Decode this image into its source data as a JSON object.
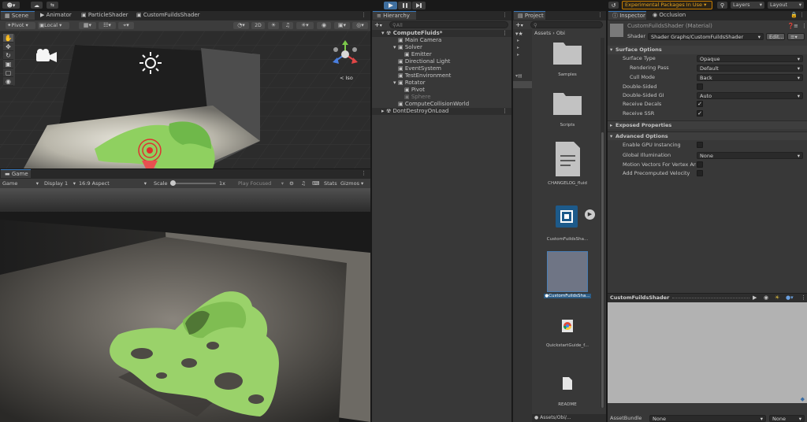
{
  "app": {
    "account_label": "▾",
    "cloud_icon": "cloud-icon",
    "collab_icon": "collab-icon"
  },
  "toolbar": {
    "play_icon": "play-icon",
    "pause_icon": "pause-icon",
    "step_icon": "step-icon",
    "experimental_label": "Experimental Packages In Use",
    "layers_label": "Layers",
    "layout_label": "Layout"
  },
  "scene": {
    "tabs": [
      "Scene",
      "Animator",
      "ParticleShader",
      "CustomFuildsShader"
    ],
    "pivot_label": "Pivot",
    "local_label": "Local",
    "mode_2d": "2D",
    "iso_label": "Iso",
    "light_color": "#f5f5f5"
  },
  "game": {
    "tab_label": "Game",
    "display_mode": "Game",
    "display": "Display 1",
    "aspect": "16:9 Aspect",
    "scale_label": "Scale",
    "scale_value": "1x",
    "play_focused": "Play Focused",
    "stats": "Stats",
    "gizmos": "Gizmos",
    "fluid_color": "#9ad26a"
  },
  "hierarchy": {
    "tab_label": "Hierarchy",
    "search_placeholder": "All",
    "items": [
      {
        "label": "ComputeFluids*",
        "depth": 0,
        "bold": true,
        "icon": "unity-scene-icon"
      },
      {
        "label": "Main Camera",
        "depth": 1,
        "icon": "gameobject-icon"
      },
      {
        "label": "Solver",
        "depth": 1,
        "icon": "gameobject-icon"
      },
      {
        "label": "Emitter",
        "depth": 2,
        "icon": "gameobject-icon"
      },
      {
        "label": "Directional Light",
        "depth": 1,
        "icon": "gameobject-icon"
      },
      {
        "label": "EventSystem",
        "depth": 1,
        "icon": "gameobject-icon"
      },
      {
        "label": "TestEnvironment",
        "depth": 1,
        "icon": "gameobject-icon"
      },
      {
        "label": "Rotator",
        "depth": 1,
        "icon": "gameobject-icon"
      },
      {
        "label": "Pivot",
        "depth": 2,
        "icon": "gameobject-icon"
      },
      {
        "label": "Sphere",
        "depth": 2,
        "dim": true,
        "icon": "gameobject-icon"
      },
      {
        "label": "ComputeCollisionWorld",
        "depth": 1,
        "icon": "gameobject-icon"
      },
      {
        "label": "DontDestroyOnLoad",
        "depth": 0,
        "bold": false,
        "icon": "unity-scene-icon"
      }
    ]
  },
  "project": {
    "tab_label": "Project",
    "breadcrumb": [
      "Assets",
      "Obi"
    ],
    "items": [
      {
        "label": "Samples",
        "kind": "folder"
      },
      {
        "label": "Scripts",
        "kind": "folder"
      },
      {
        "label": "CHANGELOG_fluid",
        "kind": "document"
      },
      {
        "label": "CustomFuildsSha...",
        "kind": "shadergraph"
      },
      {
        "label": "CustomFuildsSha...",
        "kind": "material"
      },
      {
        "label": "QuickstartGuide_f...",
        "kind": "chrome"
      },
      {
        "label": "README",
        "kind": "file"
      }
    ],
    "footer_path": "Assets/Obi/..."
  },
  "inspector": {
    "tabs": [
      "Inspector",
      "Occlusion"
    ],
    "title": "CustomFuildsShader (Material)",
    "shader_label": "Shader",
    "shader_value": "Shader Graphs/CustomFuildsShader",
    "edit_label": "Edit...",
    "sections": {
      "surface": "Surface Options",
      "exposed": "Exposed Properties",
      "advanced": "Advanced Options"
    },
    "surface_rows": [
      {
        "label": "Surface Type",
        "value": "Opaque"
      },
      {
        "label": "Rendering Pass",
        "value": "Default",
        "indent": true
      },
      {
        "label": "Cull Mode",
        "value": "Back",
        "indent": true
      },
      {
        "label": "Double-Sided"
      },
      {
        "label": "Double-Sided GI",
        "value": "Auto"
      },
      {
        "label": "Receive Decals",
        "checked": true
      },
      {
        "label": "Receive SSR",
        "checked": true
      }
    ],
    "advanced_rows": [
      {
        "label": "Enable GPU Instancing",
        "checked": false
      },
      {
        "label": "Global Illumination",
        "value": "None"
      },
      {
        "label": "Motion Vectors For Vertex An",
        "checked": false
      },
      {
        "label": "Add Precomputed Velocity",
        "checked": false
      }
    ],
    "preview_title": "CustomFuildsShader",
    "assetbundle_label": "AssetBundle",
    "assetbundle_value": "None",
    "assetbundle_variant": "None"
  }
}
